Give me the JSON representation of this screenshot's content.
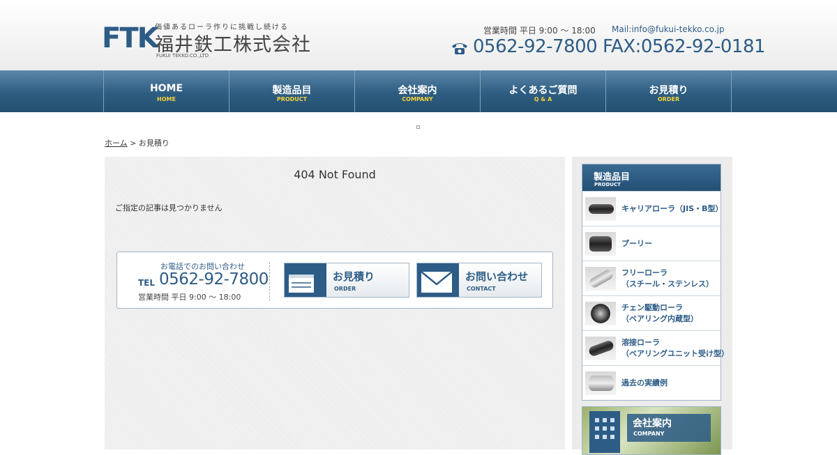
{
  "header": {
    "logo_mark": "FTK",
    "tagline": "価値あるローラ作りに挑戦し続ける",
    "company_name": "福井鉄工株式会社",
    "company_name_en": "FUKUI TEKKO.CO.,LTD",
    "hours": "営業時間 平日 9:00 〜 18:00",
    "mail": "Mail:info@fukui-tekko.co.jp",
    "tel_fax": "0562-92-7800 FAX:0562-92-0181",
    "phone_icon": "phone-icon"
  },
  "nav": [
    {
      "label": "HOME",
      "sub": "HOME"
    },
    {
      "label": "製造品目",
      "sub": "PRODUCT"
    },
    {
      "label": "会社案内",
      "sub": "COMPANY"
    },
    {
      "label": "よくあるご質問",
      "sub": "Q & A"
    },
    {
      "label": "お見積り",
      "sub": "ORDER"
    }
  ],
  "breadcrumb": {
    "home": "ホーム",
    "separator": " > ",
    "current": "お見積り"
  },
  "main": {
    "title": "404 Not Found",
    "message": "ご指定の記事は見つかりません"
  },
  "contact_box": {
    "label": "お電話でのお問い合わせ",
    "tel_prefix": "TEL",
    "tel": "0562-92-7800",
    "hours": "営業時間 平日 9:00 〜 18:00",
    "order_button": {
      "label": "お見積り",
      "sub": "ORDER",
      "icon": "document-icon"
    },
    "contact_button": {
      "label": "お問い合わせ",
      "sub": "CONTACT",
      "icon": "envelope-icon"
    }
  },
  "sidebar": {
    "products_title": "製造品目",
    "products_sub": "PRODUCT",
    "items": [
      {
        "label": "キャリアローラ（JIS・B型）"
      },
      {
        "label": "プーリー"
      },
      {
        "label_line1": "フリーローラ",
        "label_line2": "（スチール・ステンレス）"
      },
      {
        "label_line1": "チェン駆動ローラ",
        "label_line2": "（ベアリング内蔵型）"
      },
      {
        "label_line1": "溶接ローラ",
        "label_line2": "（ベアリングユニット受け型）"
      },
      {
        "label": "過去の実績例"
      }
    ],
    "company_banner": {
      "label": "会社案内",
      "sub": "COMPANY",
      "icon": "building-icon"
    }
  },
  "colors": {
    "brand_blue": "#2d5c86",
    "nav_accent_yellow": "#f3d23c"
  }
}
